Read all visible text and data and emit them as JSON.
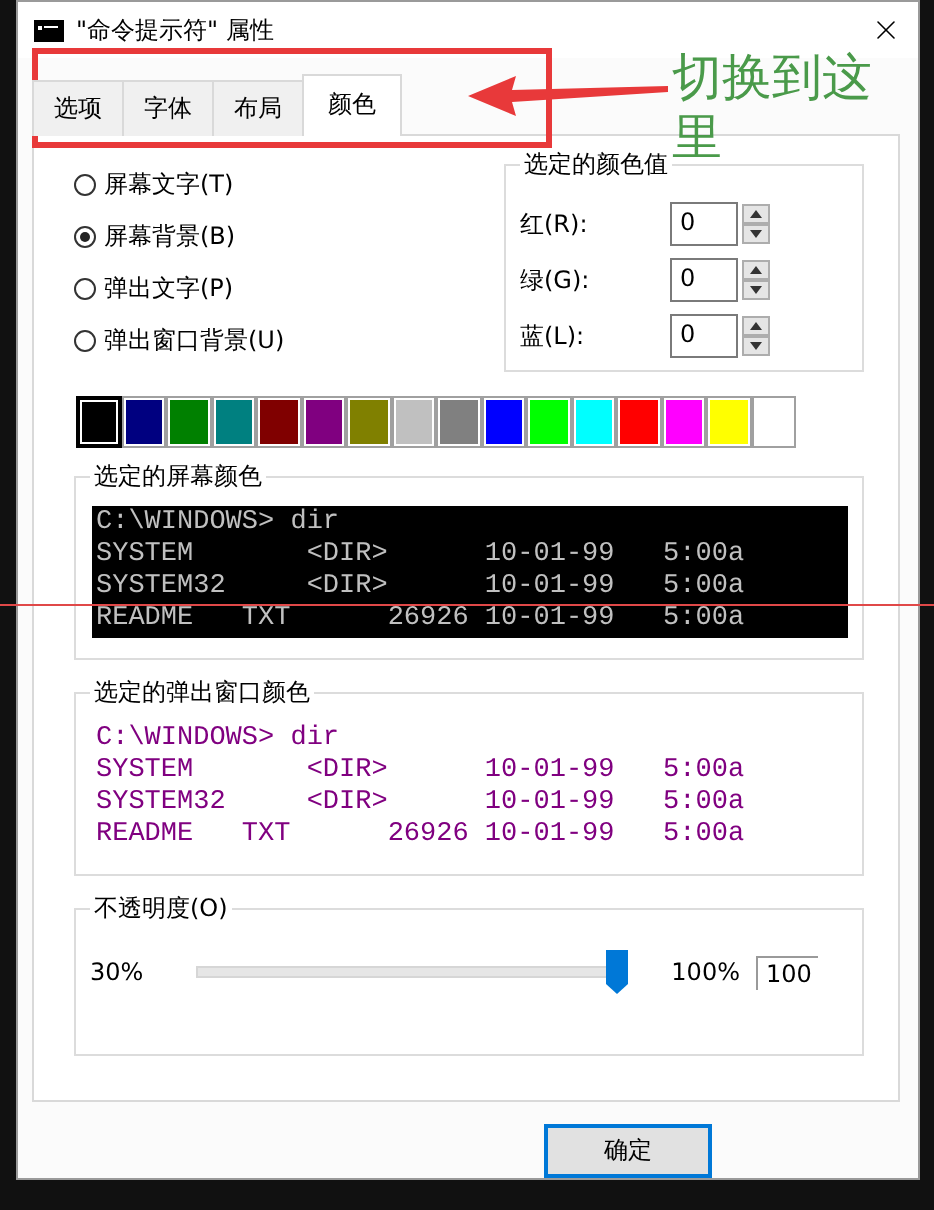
{
  "window": {
    "title": "\"命令提示符\" 属性"
  },
  "tabs": [
    {
      "label": "选项",
      "selected": false
    },
    {
      "label": "字体",
      "selected": false
    },
    {
      "label": "布局",
      "selected": false
    },
    {
      "label": "颜色",
      "selected": true
    }
  ],
  "annotation": {
    "text": "切换到这里"
  },
  "radios": [
    {
      "label": "屏幕文字(T)",
      "selected": false
    },
    {
      "label": "屏幕背景(B)",
      "selected": true
    },
    {
      "label": "弹出文字(P)",
      "selected": false
    },
    {
      "label": "弹出窗口背景(U)",
      "selected": false
    }
  ],
  "color_values": {
    "title": "选定的颜色值",
    "fields": [
      {
        "label": "红(R):",
        "value": "0"
      },
      {
        "label": "绿(G):",
        "value": "0"
      },
      {
        "label": "蓝(L):",
        "value": "0"
      }
    ]
  },
  "palette": [
    {
      "color": "#000000",
      "selected": true
    },
    {
      "color": "#000080",
      "selected": false
    },
    {
      "color": "#008000",
      "selected": false
    },
    {
      "color": "#008080",
      "selected": false
    },
    {
      "color": "#800000",
      "selected": false
    },
    {
      "color": "#800080",
      "selected": false
    },
    {
      "color": "#808000",
      "selected": false
    },
    {
      "color": "#c0c0c0",
      "selected": false
    },
    {
      "color": "#808080",
      "selected": false
    },
    {
      "color": "#0000ff",
      "selected": false
    },
    {
      "color": "#00ff00",
      "selected": false
    },
    {
      "color": "#00ffff",
      "selected": false
    },
    {
      "color": "#ff0000",
      "selected": false
    },
    {
      "color": "#ff00ff",
      "selected": false
    },
    {
      "color": "#ffff00",
      "selected": false
    },
    {
      "color": "#ffffff",
      "selected": false
    }
  ],
  "screen_preview": {
    "title": "选定的屏幕颜色",
    "lines": [
      "C:\\WINDOWS> dir",
      "SYSTEM       <DIR>      10-01-99   5:00a",
      "SYSTEM32     <DIR>      10-01-99   5:00a",
      "README   TXT      26926 10-01-99   5:00a"
    ]
  },
  "popup_preview": {
    "title": "选定的弹出窗口颜色",
    "lines": [
      "C:\\WINDOWS> dir",
      "SYSTEM       <DIR>      10-01-99   5:00a",
      "SYSTEM32     <DIR>      10-01-99   5:00a",
      "README   TXT      26926 10-01-99   5:00a"
    ]
  },
  "opacity": {
    "title": "不透明度(O)",
    "min_label": "30%",
    "max_label": "100%",
    "level": 1,
    "value": "100"
  },
  "buttons": [
    "确定"
  ]
}
